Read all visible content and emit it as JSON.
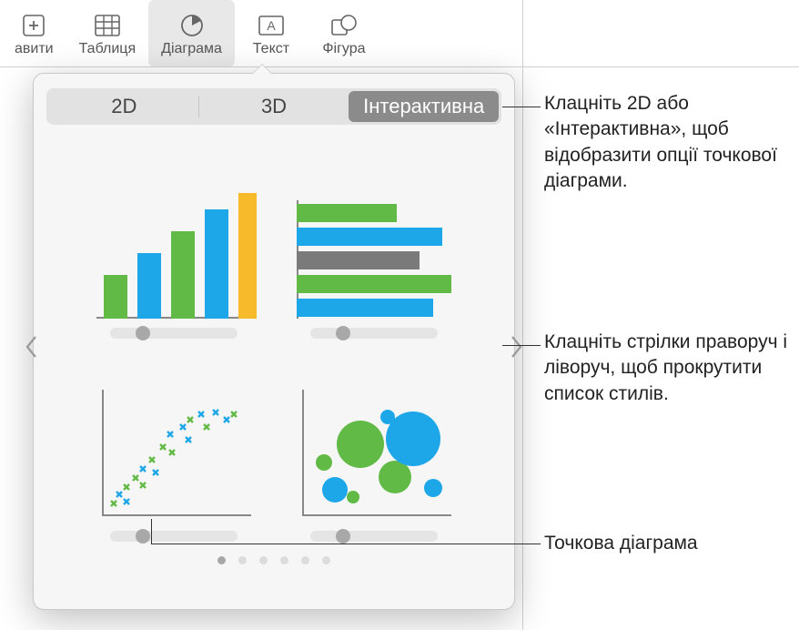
{
  "toolbar": {
    "items": [
      {
        "id": "insert",
        "label": "авити",
        "icon": "plus-square"
      },
      {
        "id": "table",
        "label": "Таблиця",
        "icon": "table"
      },
      {
        "id": "chart",
        "label": "Діаграма",
        "icon": "pie",
        "active": true
      },
      {
        "id": "text",
        "label": "Текст",
        "icon": "textbox"
      },
      {
        "id": "shape",
        "label": "Фігура",
        "icon": "shapes"
      }
    ]
  },
  "popover": {
    "tabs": {
      "twoD": "2D",
      "threeD": "3D",
      "interactive": "Інтерактивна",
      "selected": "interactive"
    },
    "charts": [
      {
        "id": "column",
        "name": "column-chart"
      },
      {
        "id": "bar",
        "name": "horizontal-bar-chart"
      },
      {
        "id": "scatter",
        "name": "scatter-chart"
      },
      {
        "id": "bubble",
        "name": "bubble-chart"
      }
    ],
    "pageDots": {
      "count": 6,
      "active": 0
    }
  },
  "callouts": {
    "tabs": "Клацніть 2D або «Інтерактивна», щоб відобразити опції точкової діаграми.",
    "arrows": "Клацніть стрілки праворуч і ліворуч, щоб прокрутити список стилів.",
    "scatter": "Точкова діаграма"
  },
  "colors": {
    "green": "#62ba46",
    "blue": "#1ea7e8",
    "gray": "#7a7a7a",
    "yellow": "#f7ba2b"
  }
}
